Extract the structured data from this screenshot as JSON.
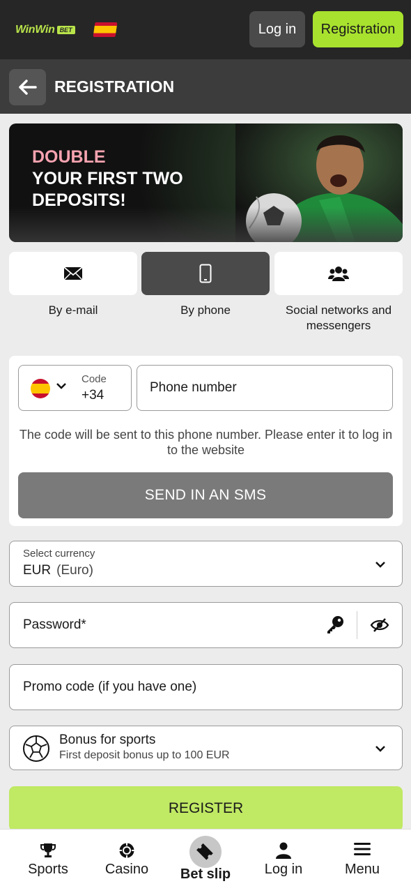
{
  "header": {
    "logo_text": "WinWin",
    "logo_badge": "BET",
    "login_label": "Log in",
    "registration_label": "Registration"
  },
  "titlebar": {
    "title": "REGISTRATION"
  },
  "banner": {
    "line1": "DOUBLE",
    "line2": "YOUR FIRST TWO",
    "line3": "DEPOSITS!"
  },
  "methods": [
    {
      "label": "By e-mail",
      "icon": "envelope-icon",
      "active": false
    },
    {
      "label": "By phone",
      "icon": "phone-icon",
      "active": true
    },
    {
      "label": "Social networks and messengers",
      "icon": "users-icon",
      "active": false
    }
  ],
  "phone": {
    "code_label": "Code",
    "code_value": "+34",
    "number_placeholder": "Phone number",
    "hint": "The code will be sent to this phone number. Please enter it to log in to the website",
    "send_label": "SEND IN AN SMS"
  },
  "currency": {
    "label": "Select currency",
    "code": "EUR",
    "name": "(Euro)"
  },
  "password": {
    "placeholder": "Password*"
  },
  "promo": {
    "placeholder": "Promo code (if you have one)"
  },
  "bonus": {
    "title": "Bonus for sports",
    "subtitle": "First deposit bonus up to 100 EUR"
  },
  "register_label": "REGISTER",
  "bottom_nav": [
    {
      "label": "Sports",
      "icon": "trophy-icon"
    },
    {
      "label": "Casino",
      "icon": "casino-chip-icon"
    },
    {
      "label": "Bet slip",
      "icon": "ticket-icon"
    },
    {
      "label": "Log in",
      "icon": "user-icon"
    },
    {
      "label": "Menu",
      "icon": "menu-icon"
    }
  ],
  "colors": {
    "accent_green": "#a8e22e",
    "register_green": "#c0e964",
    "header_bg": "#262626",
    "title_bg": "#3c3c3c"
  }
}
